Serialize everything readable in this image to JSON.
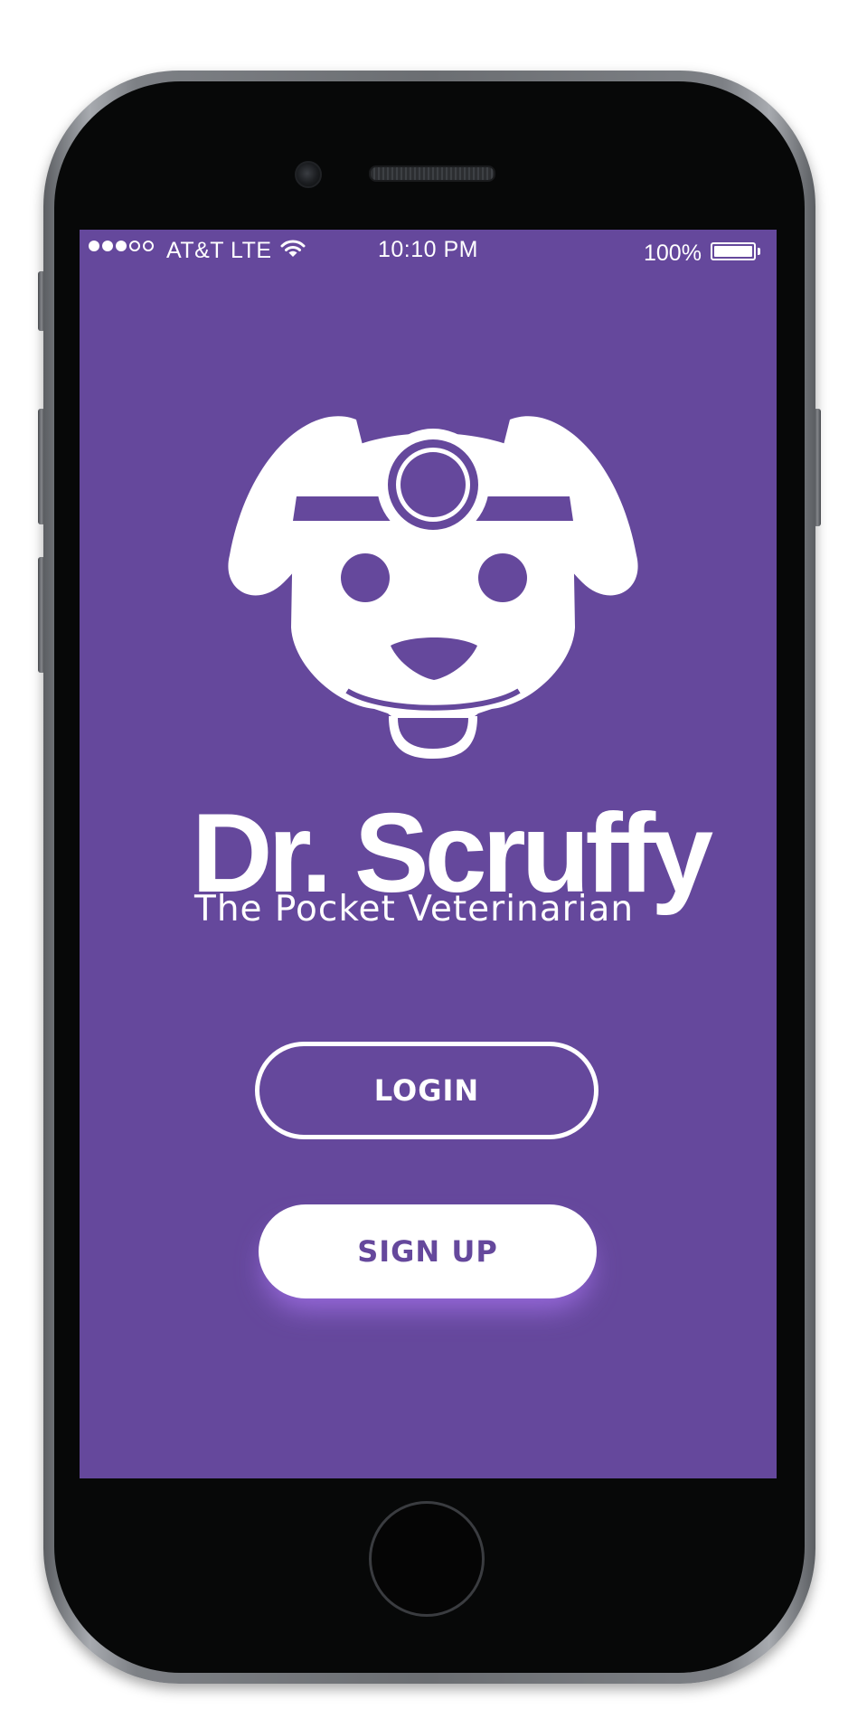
{
  "status_bar": {
    "carrier": "AT&T LTE",
    "time": "10:10 PM",
    "battery": "100%",
    "signal_bars": 3,
    "signal_max": 5,
    "battery_level": 1.0,
    "icons": [
      "signal-dots-icon",
      "wifi-icon",
      "battery-icon"
    ]
  },
  "brand": {
    "name": "Dr. Scruffy",
    "tagline": "The Pocket Veterinarian",
    "logo": "dog-with-head-mirror-logo"
  },
  "actions": {
    "login_label": "LOGIN",
    "signup_label": "SIGN UP"
  },
  "colors": {
    "primary": "#65489c",
    "on_primary": "#ffffff",
    "signup_glow": "#a06ee6"
  }
}
